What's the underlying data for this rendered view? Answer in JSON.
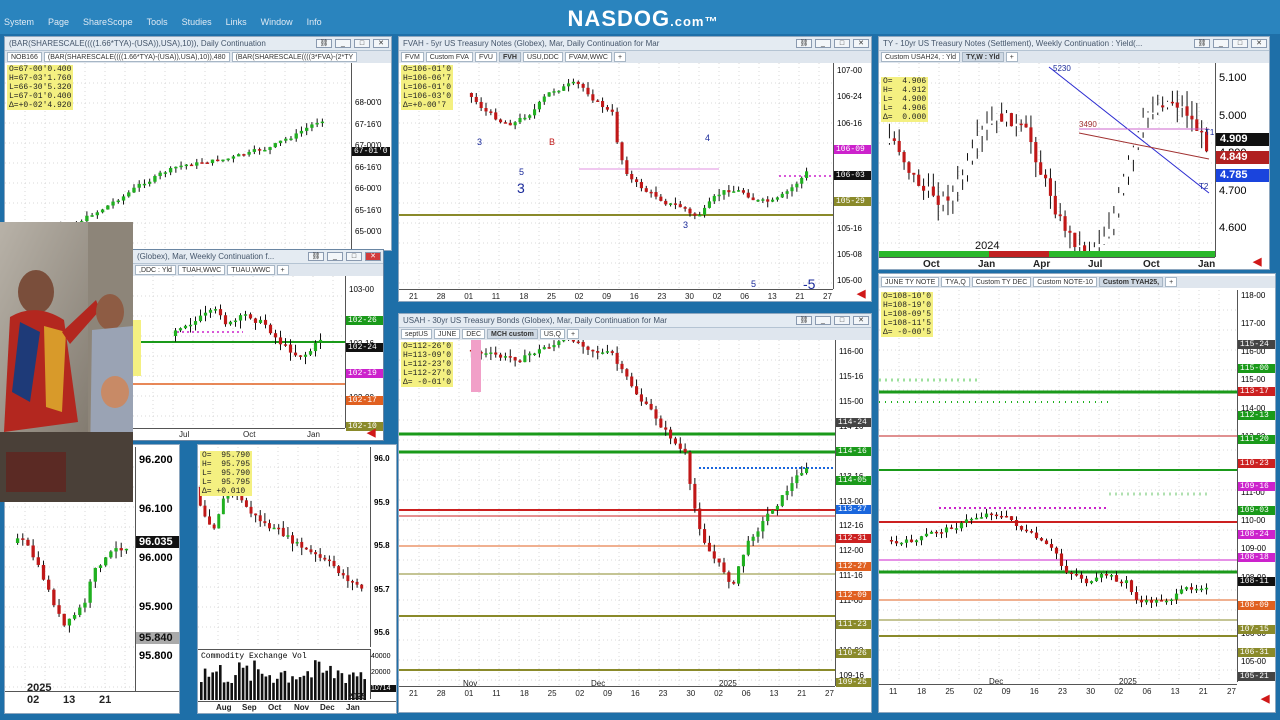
{
  "site": {
    "logo": "NASDOG",
    "logo_suffix": ".com™"
  },
  "menu": [
    "System",
    "Page",
    "ShareScope",
    "Tools",
    "Studies",
    "Links",
    "Window",
    "Info"
  ],
  "w1": {
    "title": "(BAR(SHARESCALE((((1.66*TYA)-(USA)),USA),10)), Daily Continuation",
    "tabs": [
      "NOB166",
      "(BAR(SHARESCALE((((1.66*TYA)-(USA)),USA),10)),480",
      "(BAR(SHARESCALE((((3*FVA)-(2*TY"
    ],
    "ohlc": "O=67-00'0.400\nH=67-03'1.760\nL=66-30'5.320\nL=67-01'0.400\nΔ=+0-02'4.920",
    "yticks": [
      "68-00'0",
      "67-16'0",
      "67-00'0",
      "66-16'0",
      "66-00'0",
      "65-16'0",
      "65-00'0"
    ],
    "last_tag": "67-01'0",
    "x_year": "2025"
  },
  "w2": {
    "title": "FVAH - 5yr US Treasury Notes (Globex), Mar, Daily Continuation for Mar",
    "tabs": [
      "FVM",
      "Custom FVA",
      "FVU",
      "FVH",
      "USU,DDC",
      "FVAM,WWC",
      "+"
    ],
    "ohlc": "O=106-01'0\nH=106-06'7\nL=106-01'0\nL=106-03'0\nΔ=+0-00'7",
    "yticks": [
      "107-00",
      "106-24",
      "106-16",
      "106-08",
      "106-00",
      "105-24",
      "105-16",
      "105-08",
      "105-00"
    ],
    "tags": [
      {
        "v": "106-09",
        "c": "#cc22cc"
      },
      {
        "v": "106-03",
        "c": "#111111"
      },
      {
        "v": "105-29",
        "c": "#8a8a2a"
      }
    ],
    "xticks": [
      "21",
      "28",
      "01",
      "11",
      "18",
      "25",
      "02",
      "09",
      "16",
      "23",
      "30",
      "02",
      "06",
      "13",
      "21",
      "27"
    ],
    "months": [
      "Nov",
      "Dec",
      "2025"
    ],
    "labels": [
      "3",
      "5",
      "3",
      "B",
      "4",
      "3",
      "5",
      "5",
      "-5"
    ]
  },
  "w3": {
    "title": "TY - 10yr US Treasury Notes (Settlement), Weekly Continuation : Yield(...",
    "tabs": [
      "Custom USAH24, : Yld",
      "TY,W : Yld",
      "+"
    ],
    "ohlc": "O=  4.906\nH=  4.912\nL=  4.900\nL=  4.906\nΔ=  0.000",
    "yticks": [
      "5.100",
      "5.000",
      "4.800",
      "4.700",
      "4.600"
    ],
    "tags": [
      {
        "v": "4.909",
        "c": "#111111"
      },
      {
        "v": "4.849",
        "c": "#b02020"
      },
      {
        "v": "4.785",
        "c": "#1a44dd"
      }
    ],
    "months": [
      "Oct",
      "Jan",
      "Apr",
      "Jul",
      "Oct",
      "Jan"
    ],
    "year": "2024",
    "notes": [
      "5230",
      "3490",
      "T1",
      "T2"
    ]
  },
  "w4": {
    "title": "(Globex), Mar, Weekly Continuation f...",
    "tabs": [
      ",DDC : Yld",
      "TUAH,WWC",
      "TUAU,WWC",
      "+"
    ],
    "yticks": [
      "103-00",
      "102-16",
      "102-00"
    ],
    "tags": [
      {
        "v": "102-26",
        "c": "#1a9a1a"
      },
      {
        "v": "102-24",
        "c": "#111111"
      },
      {
        "v": "102-19",
        "c": "#cc22cc"
      },
      {
        "v": "102-17",
        "c": "#e06020"
      },
      {
        "v": "102-10",
        "c": "#8a8a2a"
      }
    ],
    "months": [
      "Jul",
      "Oct",
      "Jan"
    ],
    "year": "2025"
  },
  "w5": {
    "title": "USAH - 30yr US Treasury Bonds (Globex), Mar, Daily Continuation for Mar",
    "tabs": [
      "septUS",
      "JUNE",
      "DEC",
      "MCH custom",
      "US,Q",
      "+"
    ],
    "ohlc": "O=112-26'0\nH=113-09'0\nL=112-23'0\nL=112-27'0\nΔ= -0-01'0",
    "yticks": [
      "116-00",
      "115-16",
      "115-00",
      "114-16",
      "114-00",
      "113-16",
      "113-00",
      "112-16",
      "112-00",
      "111-16",
      "111-00",
      "110-16",
      "110-00",
      "109-16"
    ],
    "tags": [
      {
        "v": "114-24",
        "c": "#444444"
      },
      {
        "v": "114-16",
        "c": "#1a9a1a"
      },
      {
        "v": "114-05",
        "c": "#1a9a1a"
      },
      {
        "v": "113-27",
        "c": "#1a66dd"
      },
      {
        "v": "112-31",
        "c": "#cc2020"
      },
      {
        "v": "112-27",
        "c": "#e06020"
      },
      {
        "v": "112-09",
        "c": "#e06020"
      },
      {
        "v": "111-23",
        "c": "#8a8a2a"
      },
      {
        "v": "110-26",
        "c": "#8a8a2a"
      },
      {
        "v": "109-25",
        "c": "#8a8a2a"
      }
    ],
    "xticks": [
      "21",
      "28",
      "01",
      "11",
      "18",
      "25",
      "02",
      "09",
      "16",
      "23",
      "30",
      "02",
      "06",
      "13",
      "21",
      "27"
    ],
    "months": [
      "Nov",
      "Dec",
      "2025"
    ]
  },
  "w6": {
    "title": "",
    "tabs": [
      "JUNE TY NOTE",
      "TYA,Q",
      "Custom TY DEC",
      "Custom NOTE-10",
      "Custom TYAH25,",
      "+"
    ],
    "ohlc": "O=108-10'0\nH=108-19'0\nL=108-09'5\nL=108-11'5\nΔ= -0-00'5",
    "yticks": [
      "118-00",
      "117-00",
      "116-00",
      "115-00",
      "114-00",
      "113-00",
      "112-00",
      "111-00",
      "110-00",
      "109-00",
      "108-00",
      "107-00",
      "106-00",
      "105-00"
    ],
    "tags": [
      {
        "v": "115-24",
        "c": "#444444"
      },
      {
        "v": "115-00",
        "c": "#1a9a1a"
      },
      {
        "v": "113-17",
        "c": "#cc2020"
      },
      {
        "v": "112-13",
        "c": "#1a9a1a"
      },
      {
        "v": "111-20",
        "c": "#1a9a1a"
      },
      {
        "v": "110-23",
        "c": "#cc2020"
      },
      {
        "v": "109-16",
        "c": "#cc22cc"
      },
      {
        "v": "109-03",
        "c": "#1a9a1a"
      },
      {
        "v": "108-24",
        "c": "#cc22cc"
      },
      {
        "v": "108-18",
        "c": "#cc22cc"
      },
      {
        "v": "108-11",
        "c": "#111111"
      },
      {
        "v": "108-09",
        "c": "#e06020"
      },
      {
        "v": "107-15",
        "c": "#8a8a2a"
      },
      {
        "v": "106-31",
        "c": "#8a8a2a"
      },
      {
        "v": "105-21",
        "c": "#444444"
      }
    ],
    "xticks": [
      "11",
      "18",
      "25",
      "02",
      "09",
      "16",
      "23",
      "30",
      "02",
      "06",
      "13",
      "21",
      "27"
    ],
    "months": [
      "Dec",
      "2025"
    ]
  },
  "w7": {
    "yticks": [
      "96.200",
      "96.100",
      "96.000",
      "95.900",
      "95.800"
    ],
    "tags": [
      {
        "v": "96.035",
        "c": "#111111"
      },
      {
        "v": "95.840",
        "c": "#888888"
      }
    ],
    "year": "2025",
    "xticks": [
      "02",
      "13",
      "21"
    ]
  },
  "w8": {
    "ohlc": "O=  95.790\nH=  95.795\nL=  95.790\nL=  95.795\nΔ= +0.010",
    "yticks": [
      "96.0",
      "95.9",
      "95.8",
      "95.7",
      "95.6"
    ],
    "vol_title": "Commodity Exchange Vol",
    "vol_ticks": [
      "40000",
      "20000"
    ],
    "vol_tag": "10714",
    "months": [
      "Aug",
      "Sep",
      "Oct",
      "Nov",
      "Dec",
      "Jan"
    ],
    "year": "2025",
    "side_ticks": [
      "17"
    ]
  }
}
